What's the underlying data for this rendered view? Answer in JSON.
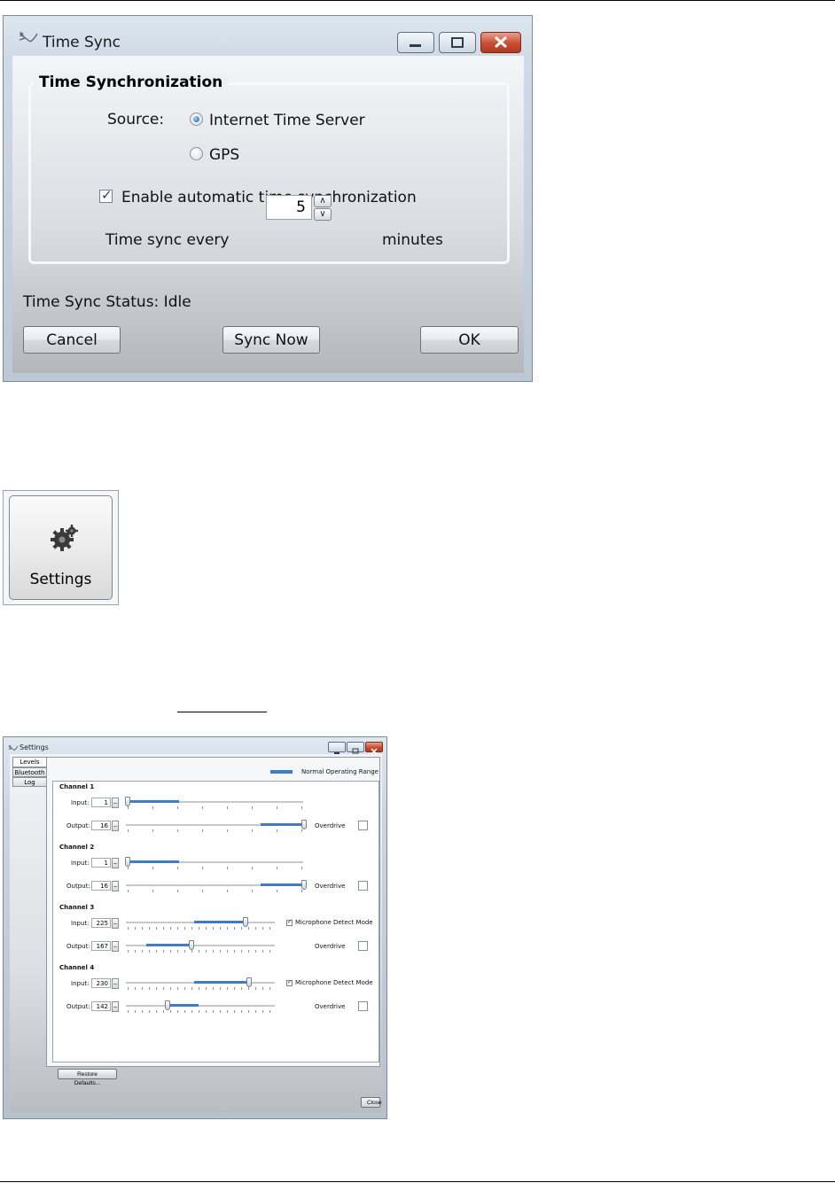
{
  "time_sync": {
    "title": "Time Sync",
    "group_title": "Time Synchronization",
    "source_label": "Source:",
    "source_options": [
      "Internet Time Server",
      "GPS"
    ],
    "selected_source": "Internet Time Server",
    "auto_sync_label": "Enable automatic time synchronization",
    "auto_sync_checked": true,
    "interval_label": "Time sync every",
    "interval_value": "5",
    "interval_unit": "minutes",
    "status_text": "Time Sync Status: Idle",
    "buttons": {
      "cancel": "Cancel",
      "sync_now": "Sync Now",
      "ok": "OK"
    }
  },
  "launcher": {
    "label": "Settings",
    "icon": "gear-icon"
  },
  "settings": {
    "title": "Settings",
    "tabs": [
      "Levels",
      "Bluetooth",
      "Log"
    ],
    "active_tab": "Levels",
    "legend_label": "Normal Operating Range",
    "colors": {
      "range": "#3e7dc6"
    },
    "input_label": "Input:",
    "output_label": "Output:",
    "overdrive_label": "Overdrive",
    "mic_detect_label": "Microphone Detect Mode",
    "channels": [
      {
        "name": "Channel 1",
        "input": "1",
        "output": "16",
        "mic_detect": false
      },
      {
        "name": "Channel 2",
        "input": "1",
        "output": "16",
        "mic_detect": false
      },
      {
        "name": "Channel 3",
        "input": "225",
        "output": "167",
        "mic_detect": true
      },
      {
        "name": "Channel 4",
        "input": "230",
        "output": "142",
        "mic_detect": true
      }
    ],
    "restore_defaults": "Restore Defaults...",
    "close": "Close"
  }
}
